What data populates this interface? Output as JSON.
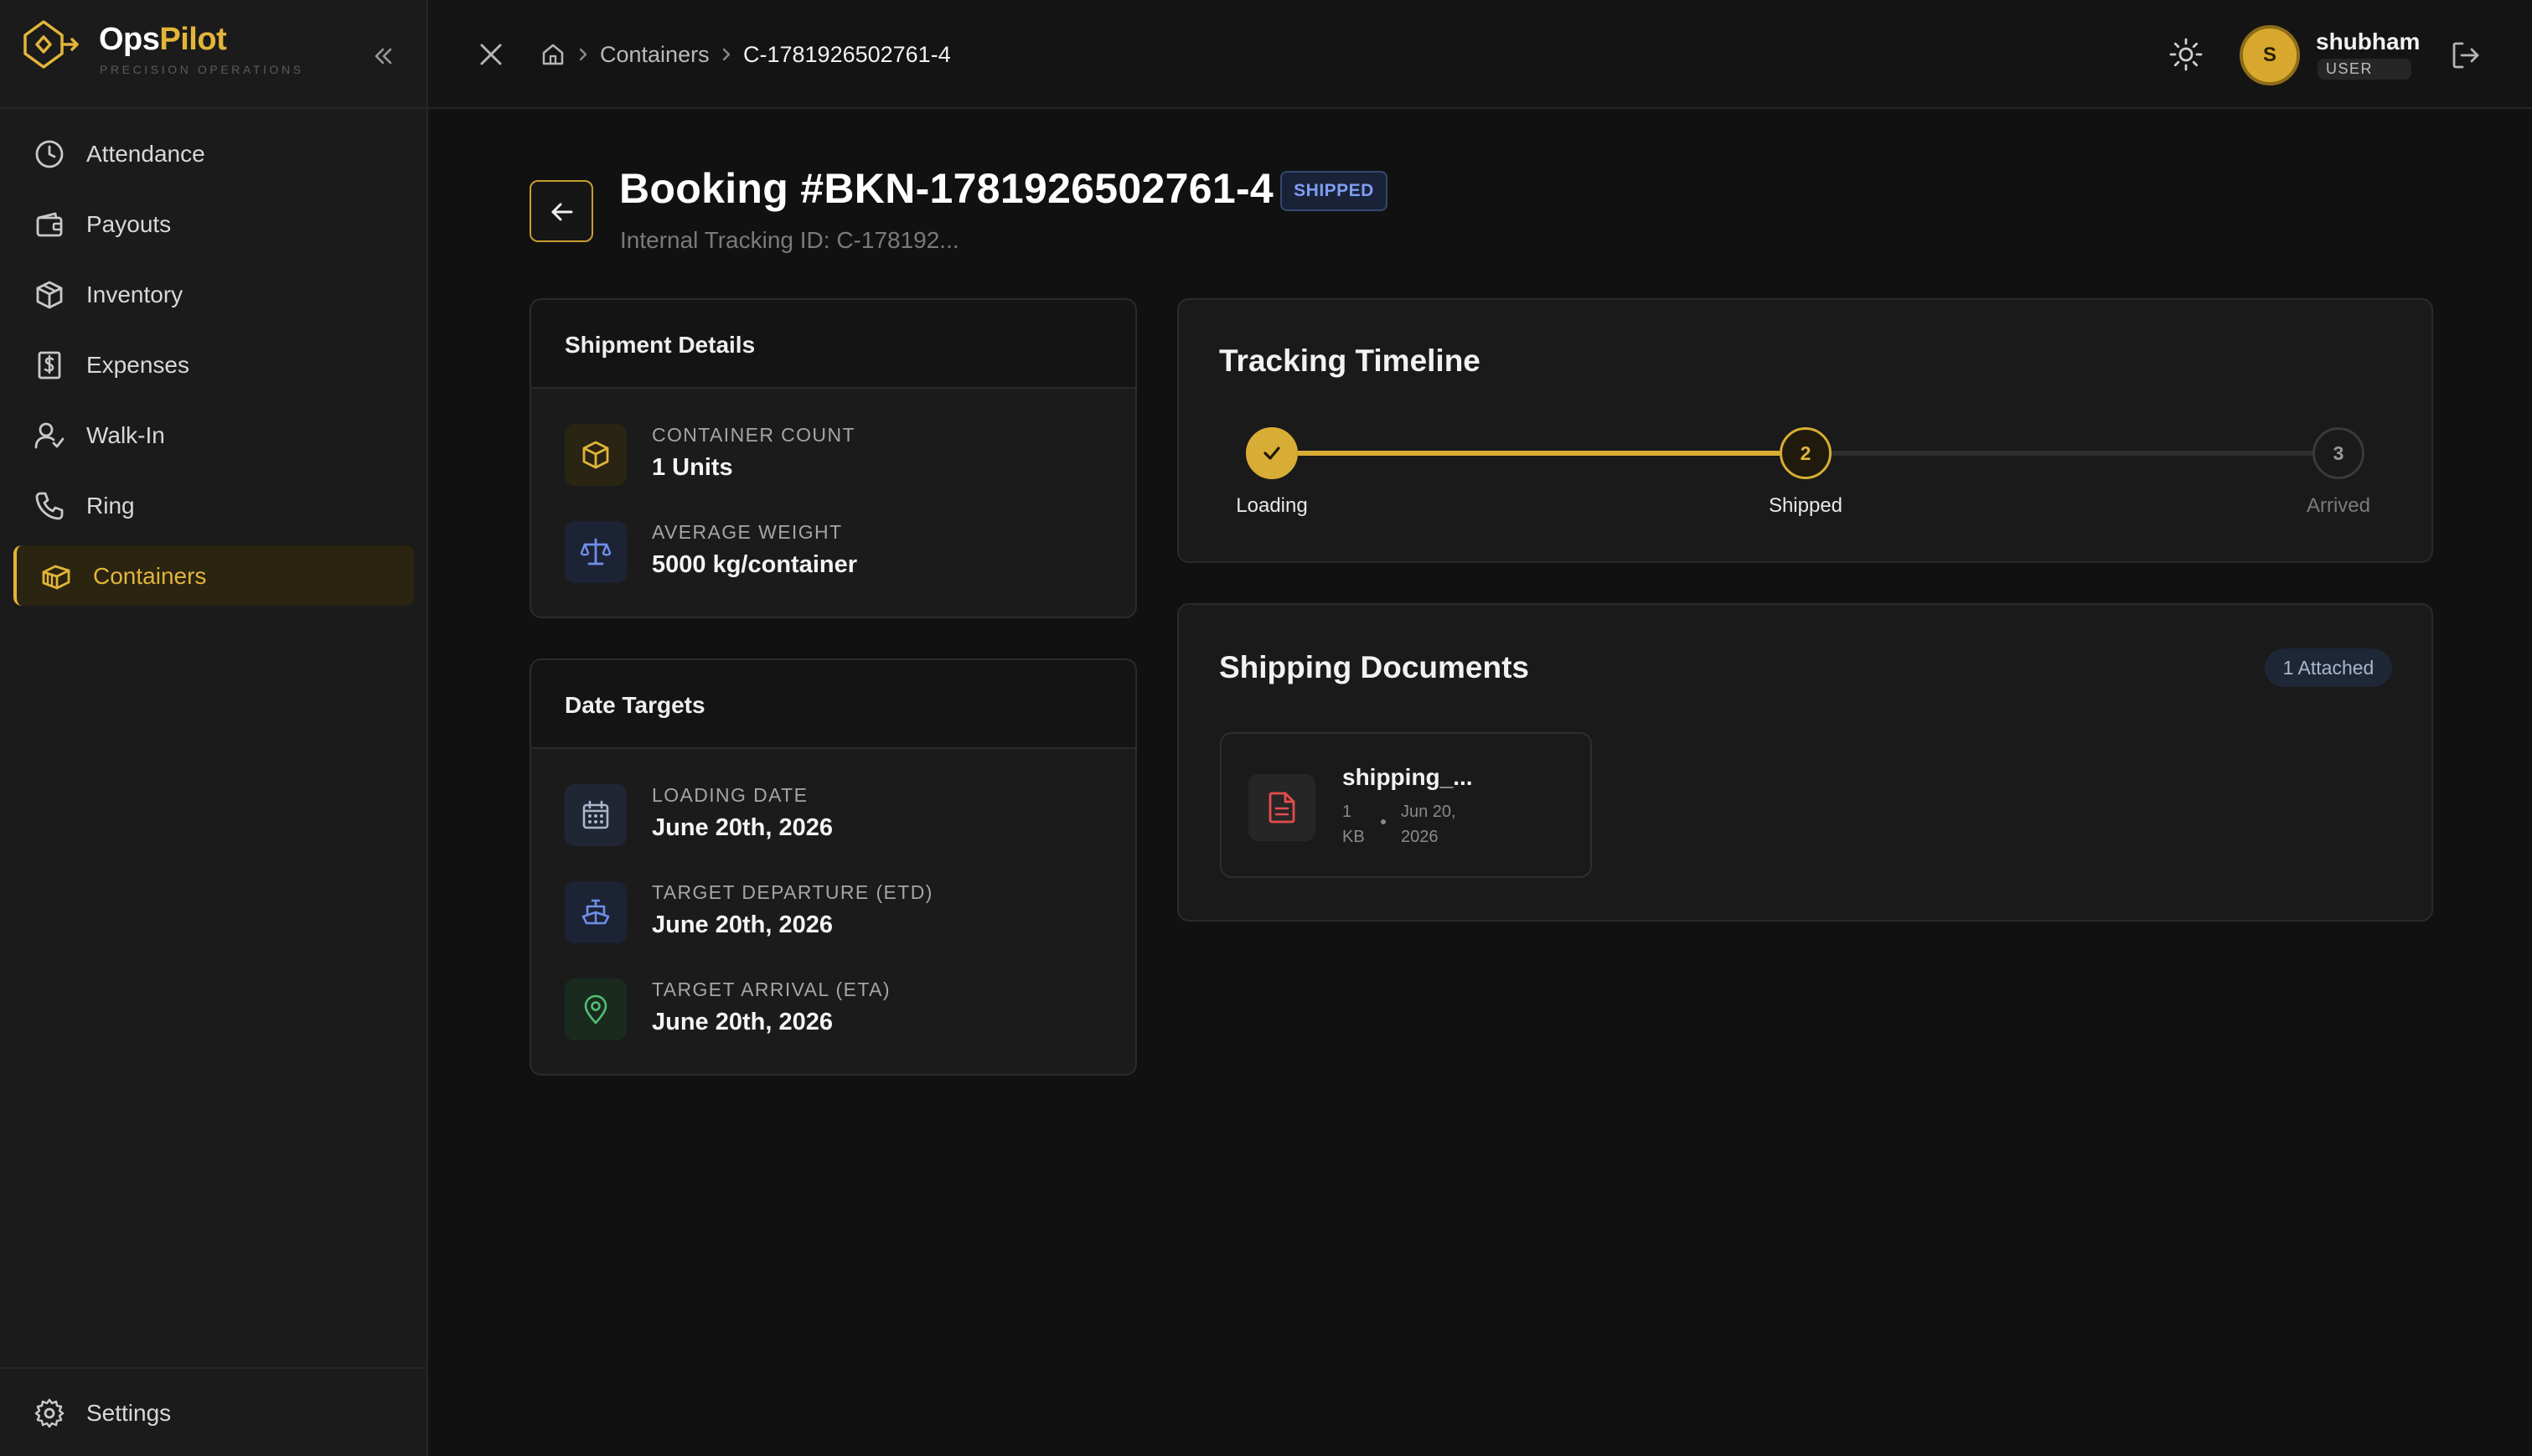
{
  "colors": {
    "accent": "#e2b53a",
    "background": "#111111",
    "sidebar": "#1b1b1b",
    "status_shipped": "#7f9ef2",
    "doc_red": "#e74c4c"
  },
  "brand": {
    "name_part1": "Ops",
    "name_part2": "Pilot",
    "tagline": "PRECISION OPERATIONS"
  },
  "sidebar": {
    "items": [
      {
        "label": "Attendance",
        "icon": "clock-icon",
        "active": false
      },
      {
        "label": "Payouts",
        "icon": "wallet-icon",
        "active": false
      },
      {
        "label": "Inventory",
        "icon": "package-icon",
        "active": false
      },
      {
        "label": "Expenses",
        "icon": "receipt-icon",
        "active": false
      },
      {
        "label": "Walk-In",
        "icon": "user-check-icon",
        "active": false
      },
      {
        "label": "Ring",
        "icon": "phone-icon",
        "active": false
      },
      {
        "label": "Containers",
        "icon": "container-icon",
        "active": true
      }
    ],
    "footer": {
      "label": "Settings",
      "icon": "gear-icon"
    }
  },
  "topbar": {
    "breadcrumb": {
      "link": "Containers",
      "current": "C-1781926502761-4"
    },
    "user": {
      "initial": "S",
      "name": "shubham",
      "role": "USER"
    }
  },
  "booking": {
    "title": "Booking #BKN-1781926502761-4",
    "status": "SHIPPED",
    "subtitle": "Internal Tracking ID: C-178192..."
  },
  "shipment_details": {
    "title": "Shipment Details",
    "rows": [
      {
        "label": "CONTAINER COUNT",
        "value": "1 Units",
        "icon": "box-icon"
      },
      {
        "label": "AVERAGE WEIGHT",
        "value": "5000 kg/container",
        "icon": "scale-icon"
      }
    ]
  },
  "date_targets": {
    "title": "Date Targets",
    "rows": [
      {
        "label": "LOADING DATE",
        "value": "June 20th, 2026",
        "icon": "calendar-icon"
      },
      {
        "label": "TARGET DEPARTURE (ETD)",
        "value": "June 20th, 2026",
        "icon": "ship-icon"
      },
      {
        "label": "TARGET ARRIVAL (ETA)",
        "value": "June 20th, 2026",
        "icon": "map-pin-icon"
      }
    ]
  },
  "timeline": {
    "title": "Tracking Timeline",
    "current_step": 2,
    "steps": [
      {
        "number": "1",
        "label": "Loading",
        "state": "done"
      },
      {
        "number": "2",
        "label": "Shipped",
        "state": "current"
      },
      {
        "number": "3",
        "label": "Arrived",
        "state": "pending"
      }
    ]
  },
  "documents": {
    "title": "Shipping Documents",
    "badge": "1 Attached",
    "items": [
      {
        "name": "shipping_...",
        "size_line1": "1",
        "size_line2": "KB",
        "date_line1": "Jun 20,",
        "date_line2": "2026",
        "icon": "file-text-icon"
      }
    ]
  }
}
